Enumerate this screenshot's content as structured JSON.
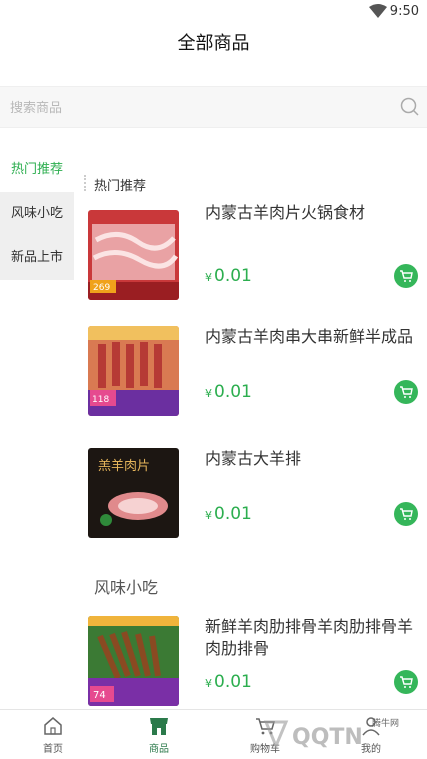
{
  "status_bar": {
    "time": "9:50"
  },
  "header": {
    "title": "全部商品"
  },
  "search": {
    "placeholder": "搜索商品"
  },
  "sidebar": {
    "items": [
      {
        "label": "热门推荐",
        "active": true
      },
      {
        "label": "风味小吃",
        "active": false
      },
      {
        "label": "新品上市",
        "active": false
      }
    ]
  },
  "sections": [
    {
      "title": "热门推荐"
    },
    {
      "title": "风味小吃"
    }
  ],
  "products": [
    {
      "name": "内蒙古羊肉片火锅食材",
      "currency": "¥",
      "price": "0.01",
      "thumb_badge": "269"
    },
    {
      "name": "内蒙古羊肉串大串新鲜半成品",
      "currency": "¥",
      "price": "0.01",
      "thumb_badge": "118"
    },
    {
      "name": "内蒙古大羊排",
      "currency": "¥",
      "price": "0.01",
      "thumb_text": "羔羊肉片"
    },
    {
      "name": "新鲜羊肉肋排骨羊肉肋排骨羊肉肋排骨",
      "currency": "¥",
      "price": "0.01",
      "thumb_badge": "74"
    }
  ],
  "tabbar": {
    "items": [
      {
        "label": "首页"
      },
      {
        "label": "商品"
      },
      {
        "label": "购物车"
      },
      {
        "label": "我的"
      }
    ]
  },
  "watermark": {
    "text": "QQTN",
    "sub": "腾牛网"
  },
  "colors": {
    "accent": "#2cae4f",
    "sidebar_bg": "#efefef",
    "tab_active": "#2b7a4b"
  }
}
